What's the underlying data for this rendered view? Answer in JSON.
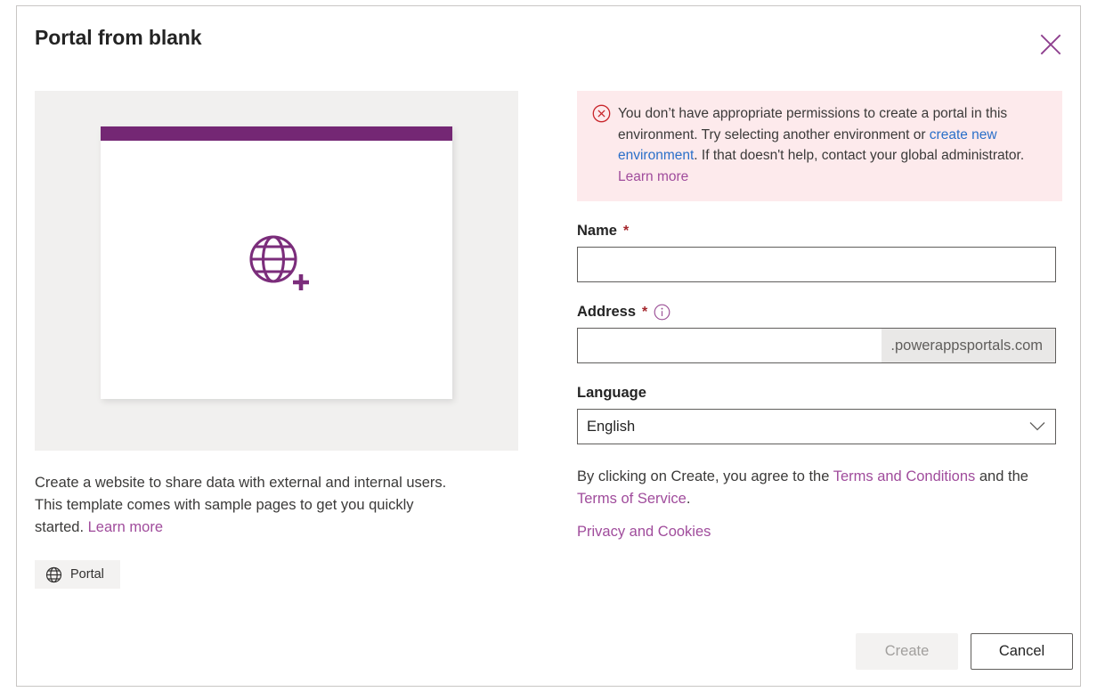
{
  "dialog": {
    "title": "Portal from blank",
    "close_icon": "close-icon"
  },
  "preview": {
    "glyph_icon": "globe-plus-icon",
    "topbar_color": "#742774"
  },
  "left": {
    "description_part1": "Create a website to share data with external and internal users. This template comes with sample pages to get you quickly started. ",
    "description_link": "Learn more",
    "tag": {
      "icon": "globe-icon",
      "label": "Portal"
    }
  },
  "error": {
    "icon": "error-circle-x-icon",
    "text_part1": "You don’t have appropriate permissions to create a portal in this environment. Try selecting another environment or ",
    "link1": "create new environment",
    "text_part2": ". If that doesn't help, contact your global administrator. ",
    "link2": "Learn more",
    "background": "#fdeaec",
    "icon_color": "#c9262c"
  },
  "form": {
    "name": {
      "label": "Name",
      "required_marker": "*",
      "value": "",
      "placeholder": ""
    },
    "address": {
      "label": "Address",
      "required_marker": "*",
      "info_icon": "info-circle-icon",
      "value": "",
      "placeholder": "",
      "suffix": ".powerappsportals.com"
    },
    "language": {
      "label": "Language",
      "selected": "English",
      "chevron_icon": "chevron-down-icon"
    }
  },
  "terms": {
    "text_part1": "By clicking on Create, you agree to the ",
    "link1": "Terms and Conditions",
    "text_part2": " and the ",
    "link2": "Terms of Service",
    "text_part3": ".",
    "privacy_link": "Privacy and Cookies"
  },
  "footer": {
    "create_label": "Create",
    "cancel_label": "Cancel"
  },
  "colors": {
    "accent_purple": "#742774",
    "link_purple": "#a04c9c",
    "link_blue": "#2a6fc9",
    "required_red": "#a4262c"
  }
}
